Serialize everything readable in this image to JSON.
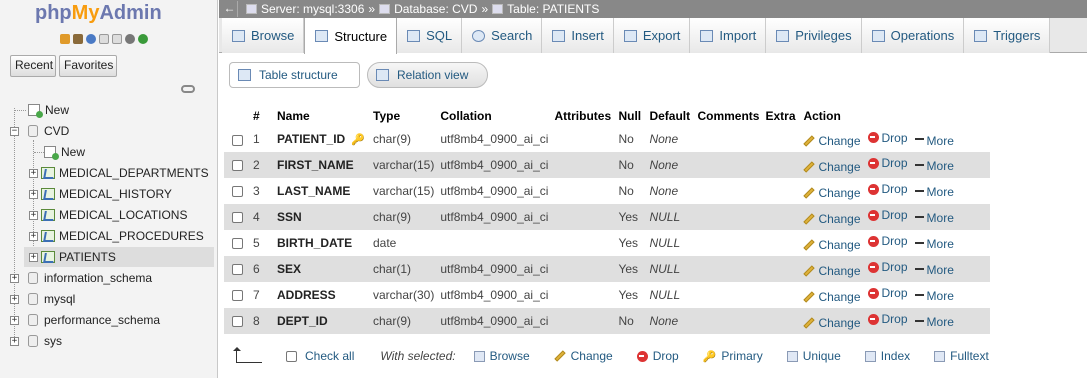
{
  "logo": {
    "php": "php",
    "my": "My",
    "admin": "Admin"
  },
  "left_tabs": {
    "recent": "Recent",
    "favorites": "Favorites"
  },
  "tree": {
    "new_top": "New",
    "cvd": "CVD",
    "new_cvd": "New",
    "tables": [
      "MEDICAL_DEPARTMENTS",
      "MEDICAL_HISTORY",
      "MEDICAL_LOCATIONS",
      "MEDICAL_PROCEDURES",
      "PATIENTS"
    ],
    "dbs": [
      "information_schema",
      "mysql",
      "performance_schema",
      "sys"
    ]
  },
  "breadcrumb": {
    "server": "Server: mysql:3306",
    "database": "Database: CVD",
    "table": "Table: PATIENTS",
    "sep": "»"
  },
  "tabs": [
    "Browse",
    "Structure",
    "SQL",
    "Search",
    "Insert",
    "Export",
    "Import",
    "Privileges",
    "Operations",
    "Triggers"
  ],
  "subnav": {
    "table_structure": "Table structure",
    "relation_view": "Relation view"
  },
  "columns_header": [
    "#",
    "Name",
    "Type",
    "Collation",
    "Attributes",
    "Null",
    "Default",
    "Comments",
    "Extra",
    "Action"
  ],
  "rows": [
    {
      "num": "1",
      "name": "PATIENT_ID",
      "type": "char(9)",
      "collation": "utf8mb4_0900_ai_ci",
      "null": "No",
      "default": "None",
      "key": true
    },
    {
      "num": "2",
      "name": "FIRST_NAME",
      "type": "varchar(15)",
      "collation": "utf8mb4_0900_ai_ci",
      "null": "No",
      "default": "None"
    },
    {
      "num": "3",
      "name": "LAST_NAME",
      "type": "varchar(15)",
      "collation": "utf8mb4_0900_ai_ci",
      "null": "No",
      "default": "None"
    },
    {
      "num": "4",
      "name": "SSN",
      "type": "char(9)",
      "collation": "utf8mb4_0900_ai_ci",
      "null": "Yes",
      "default": "NULL"
    },
    {
      "num": "5",
      "name": "BIRTH_DATE",
      "type": "date",
      "collation": "",
      "null": "Yes",
      "default": "NULL"
    },
    {
      "num": "6",
      "name": "SEX",
      "type": "char(1)",
      "collation": "utf8mb4_0900_ai_ci",
      "null": "Yes",
      "default": "NULL"
    },
    {
      "num": "7",
      "name": "ADDRESS",
      "type": "varchar(30)",
      "collation": "utf8mb4_0900_ai_ci",
      "null": "Yes",
      "default": "NULL"
    },
    {
      "num": "8",
      "name": "DEPT_ID",
      "type": "char(9)",
      "collation": "utf8mb4_0900_ai_ci",
      "null": "No",
      "default": "None"
    }
  ],
  "actions": {
    "change": "Change",
    "drop": "Drop",
    "more": "More"
  },
  "bottom": {
    "check_all": "Check all",
    "with_selected": "With selected:",
    "browse": "Browse",
    "change": "Change",
    "drop": "Drop",
    "primary": "Primary",
    "unique": "Unique",
    "index": "Index",
    "fulltext": "Fulltext"
  },
  "colors": {
    "link": "#235a81",
    "drop": "#dd3333",
    "even_row": "#dfdfdf",
    "topbar": "#888888"
  }
}
